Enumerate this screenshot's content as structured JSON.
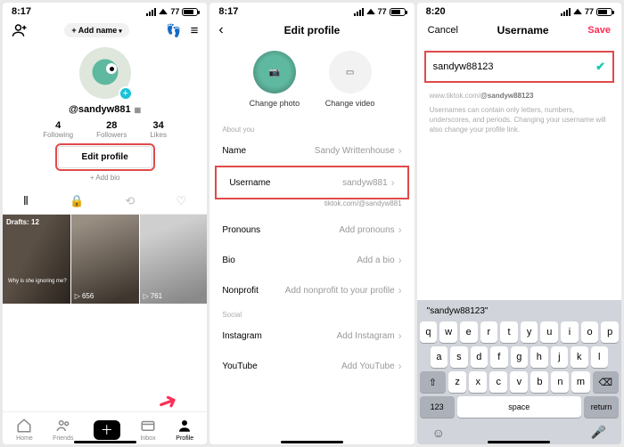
{
  "status": {
    "t1": "8:17",
    "t2": "8:17",
    "t3": "8:20",
    "batt": "77"
  },
  "s1": {
    "addname": "Add name",
    "handle": "@sandyw881",
    "stats": [
      {
        "n": "4",
        "l": "Following"
      },
      {
        "n": "28",
        "l": "Followers"
      },
      {
        "n": "34",
        "l": "Likes"
      }
    ],
    "editprofile": "Edit profile",
    "addbio": "+ Add bio",
    "drafts": "Drafts: 12",
    "cap1": "Why is she ignoring me?",
    "views2": "656",
    "views3": "761",
    "nav": [
      "Home",
      "Friends",
      "",
      "Inbox",
      "Profile"
    ]
  },
  "s2": {
    "title": "Edit profile",
    "changephoto": "Change photo",
    "changevideo": "Change video",
    "about": "About you",
    "rows": {
      "name_l": "Name",
      "name_v": "Sandy Writtenhouse",
      "user_l": "Username",
      "user_v": "sandyw881",
      "link": "tiktok.com/@sandyw881",
      "pro_l": "Pronouns",
      "pro_v": "Add pronouns",
      "bio_l": "Bio",
      "bio_v": "Add a bio",
      "non_l": "Nonprofit",
      "non_v": "Add nonprofit to your profile"
    },
    "social": "Social",
    "ig_l": "Instagram",
    "ig_v": "Add Instagram",
    "yt_l": "YouTube",
    "yt_v": "Add YouTube"
  },
  "s3": {
    "cancel": "Cancel",
    "title": "Username",
    "save": "Save",
    "input": "sandyw88123",
    "url_pre": "www.tiktok.com/",
    "url_handle": "@sandyw88123",
    "desc": "Usernames can contain only letters, numbers, underscores, and periods. Changing your username will also change your profile link.",
    "suggestion": "\"sandyw88123\"",
    "kb": {
      "r1": [
        "q",
        "w",
        "e",
        "r",
        "t",
        "y",
        "u",
        "i",
        "o",
        "p"
      ],
      "r2": [
        "a",
        "s",
        "d",
        "f",
        "g",
        "h",
        "j",
        "k",
        "l"
      ],
      "r3": [
        "z",
        "x",
        "c",
        "v",
        "b",
        "n",
        "m"
      ],
      "num": "123",
      "space": "space",
      "return": "return"
    }
  }
}
